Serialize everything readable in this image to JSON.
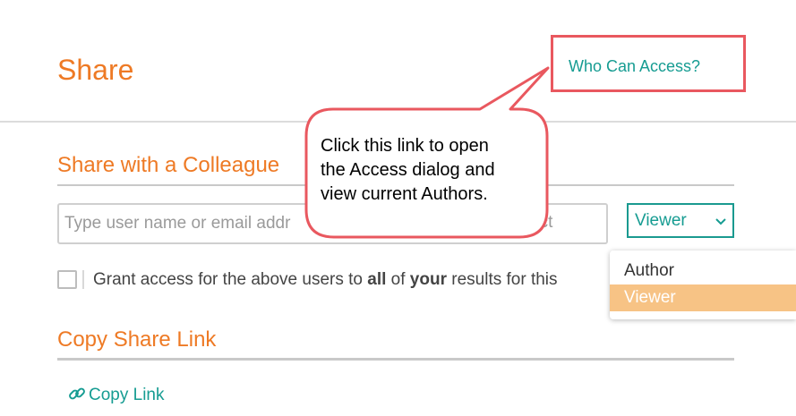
{
  "header": {
    "title": "Share",
    "who_can_access_link": "Who Can Access?"
  },
  "share_colleague": {
    "heading": "Share with a Colleague",
    "input_placeholder": "Type user name or email addr",
    "input_right_fragment": "ect",
    "role_select": {
      "selected": "Viewer",
      "options": [
        "Author",
        "Viewer"
      ]
    },
    "grant": {
      "text_1": "Grant access for the above users to ",
      "bold_1": "all",
      "text_2": " of ",
      "bold_2": "your",
      "text_3": " results for this"
    }
  },
  "copy_share": {
    "heading": "Copy Share Link",
    "copy_link_label": "Copy Link",
    "link_icon": "link-icon"
  },
  "callout": {
    "line_1": "Click this link to open",
    "line_2": "the Access dialog and",
    "line_3": "view current Authors."
  },
  "colors": {
    "accent_orange": "#ee7a25",
    "link_teal": "#169c92",
    "highlight_red": "#e9585f",
    "dropdown_selected": "#f7c385"
  }
}
